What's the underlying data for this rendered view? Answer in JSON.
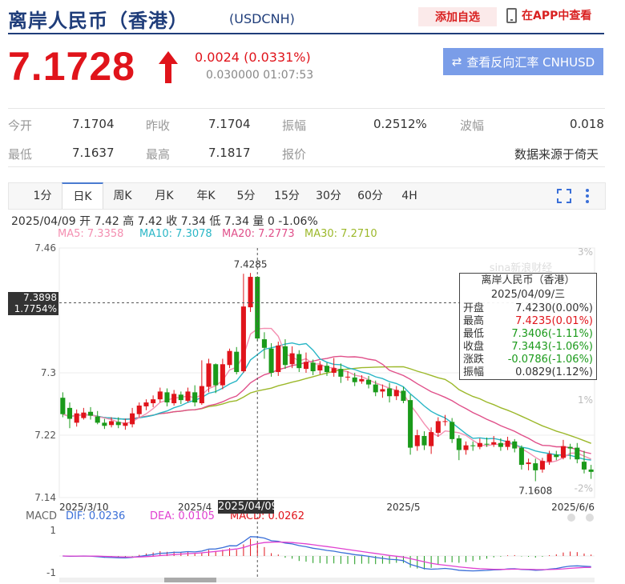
{
  "header": {
    "title": "离岸人民币（香港）",
    "code": "(USDCNH)",
    "watch_label": "添加自选",
    "app_label": "在APP中查看"
  },
  "quote": {
    "price": "7.1728",
    "change": "0.0024 (0.0331%)",
    "sub": "0.030000 01:07:53",
    "reverse_label": "查看反向汇率 CNHUSD",
    "up_color": "#e0141b"
  },
  "stats": [
    [
      {
        "label": "今开",
        "value": "7.1704"
      },
      {
        "label": "昨收",
        "value": "7.1704"
      },
      {
        "label": "振幅",
        "value": "0.2512%"
      },
      {
        "label": "波幅",
        "value": "0.018"
      }
    ],
    [
      {
        "label": "最低",
        "value": "7.1637"
      },
      {
        "label": "最高",
        "value": "7.1817"
      },
      {
        "label": "报价",
        "value": ""
      },
      {
        "label": "",
        "value": "数据来源于倚天"
      }
    ]
  ],
  "tabs": [
    "1分",
    "日K",
    "周K",
    "月K",
    "年K",
    "5分",
    "15分",
    "30分",
    "60分",
    "4H"
  ],
  "active_tab": "日K",
  "ohlc_line": "2025/04/09 开 7.42 高 7.42 收 7.34 低 7.34 量 0 -1.06%",
  "ma": [
    {
      "label": "MA5: 7.3358",
      "color": "#f48fb1"
    },
    {
      "label": "MA10: 7.3078",
      "color": "#29b6c6"
    },
    {
      "label": "MA20: 7.2773",
      "color": "#e0508a"
    },
    {
      "label": "MA30: 7.2710",
      "color": "#9cb82a"
    }
  ],
  "macd": [
    {
      "label": "MACD",
      "color": "#666"
    },
    {
      "label": "DIF: 0.0236",
      "color": "#3a6fd8"
    },
    {
      "label": "DEA: 0.0105",
      "color": "#e040d0"
    },
    {
      "label": "MACD: 0.0262",
      "color": "#e0141b"
    }
  ],
  "tooltip": {
    "title": "离岸人民币（香港）",
    "date": "2025/04/09/三",
    "rows": [
      {
        "k": "开盘",
        "v": "7.4230(0.00%)",
        "c": "#333"
      },
      {
        "k": "最高",
        "v": "7.4235(0.01%)",
        "c": "#e0141b"
      },
      {
        "k": "最低",
        "v": "7.3406(-1.11%)",
        "c": "#1a9a1a"
      },
      {
        "k": "收盘",
        "v": "7.3443(-1.06%)",
        "c": "#1a9a1a"
      },
      {
        "k": "涨跌",
        "v": "-0.0786(-1.06%)",
        "c": "#1a9a1a"
      },
      {
        "k": "振幅",
        "v": "0.0829(1.12%)",
        "c": "#333"
      }
    ]
  },
  "crosshair": {
    "price": "7.3898",
    "pct": "1.7754%",
    "date": "2025/04/09"
  },
  "chart_data": {
    "type": "candlestick",
    "y_labels": [
      "7.46",
      "7.3",
      "7.22",
      "7.14"
    ],
    "y_values": [
      7.46,
      7.3,
      7.22,
      7.14
    ],
    "right_labels": [
      "3%",
      "1%",
      "-2%"
    ],
    "x_labels": [
      "2025/3/10",
      "2025/4",
      "2025/5",
      "2025/6/6"
    ],
    "high_label": "7.4285",
    "low_label": "7.1608",
    "macd_axis": [
      "1",
      "-1"
    ],
    "watermark": "sina新浪财经",
    "candles": [
      [
        7.268,
        7.247,
        7.275,
        7.243
      ],
      [
        7.255,
        7.241,
        7.262,
        7.229
      ],
      [
        7.236,
        7.248,
        7.253,
        7.231
      ],
      [
        7.242,
        7.249,
        7.255,
        7.24
      ],
      [
        7.25,
        7.245,
        7.256,
        7.24
      ],
      [
        7.244,
        7.236,
        7.251,
        7.234
      ],
      [
        7.236,
        7.232,
        7.241,
        7.228
      ],
      [
        7.233,
        7.238,
        7.243,
        7.23
      ],
      [
        7.237,
        7.233,
        7.243,
        7.229
      ],
      [
        7.232,
        7.236,
        7.241,
        7.227
      ],
      [
        7.234,
        7.248,
        7.255,
        7.23
      ],
      [
        7.247,
        7.258,
        7.262,
        7.243
      ],
      [
        7.257,
        7.262,
        7.266,
        7.252
      ],
      [
        7.261,
        7.266,
        7.271,
        7.256
      ],
      [
        7.266,
        7.276,
        7.281,
        7.262
      ],
      [
        7.275,
        7.262,
        7.28,
        7.257
      ],
      [
        7.261,
        7.273,
        7.278,
        7.258
      ],
      [
        7.272,
        7.265,
        7.276,
        7.26
      ],
      [
        7.264,
        7.276,
        7.281,
        7.262
      ],
      [
        7.275,
        7.262,
        7.284,
        7.257
      ],
      [
        7.261,
        7.283,
        7.316,
        7.259
      ],
      [
        7.282,
        7.312,
        7.318,
        7.275
      ],
      [
        7.311,
        7.284,
        7.312,
        7.274
      ],
      [
        7.284,
        7.311,
        7.318,
        7.279
      ],
      [
        7.31,
        7.328,
        7.331,
        7.306
      ],
      [
        7.327,
        7.301,
        7.333,
        7.298
      ],
      [
        7.302,
        7.385,
        7.427,
        7.3
      ],
      [
        7.384,
        7.423,
        7.428,
        7.378
      ],
      [
        7.423,
        7.344,
        7.424,
        7.341
      ],
      [
        7.343,
        7.332,
        7.352,
        7.318
      ],
      [
        7.331,
        7.3,
        7.338,
        7.295
      ],
      [
        7.301,
        7.335,
        7.34,
        7.296
      ],
      [
        7.334,
        7.31,
        7.343,
        7.305
      ],
      [
        7.311,
        7.325,
        7.334,
        7.306
      ],
      [
        7.324,
        7.306,
        7.329,
        7.301
      ],
      [
        7.305,
        7.314,
        7.326,
        7.3
      ],
      [
        7.313,
        7.302,
        7.317,
        7.297
      ],
      [
        7.303,
        7.31,
        7.315,
        7.298
      ],
      [
        7.309,
        7.301,
        7.313,
        7.296
      ],
      [
        7.3,
        7.306,
        7.319,
        7.295
      ],
      [
        7.305,
        7.295,
        7.312,
        7.287
      ],
      [
        7.294,
        7.295,
        7.302,
        7.29
      ],
      [
        7.294,
        7.288,
        7.3,
        7.283
      ],
      [
        7.289,
        7.292,
        7.297,
        7.286
      ],
      [
        7.291,
        7.285,
        7.296,
        7.28
      ],
      [
        7.285,
        7.275,
        7.29,
        7.27
      ],
      [
        7.276,
        7.279,
        7.285,
        7.268
      ],
      [
        7.28,
        7.27,
        7.287,
        7.262
      ],
      [
        7.27,
        7.278,
        7.283,
        7.265
      ],
      [
        7.277,
        7.264,
        7.282,
        7.261
      ],
      [
        7.265,
        7.204,
        7.272,
        7.195
      ],
      [
        7.206,
        7.22,
        7.227,
        7.2
      ],
      [
        7.219,
        7.207,
        7.225,
        7.201
      ],
      [
        7.206,
        7.224,
        7.23,
        7.196
      ],
      [
        7.223,
        7.238,
        7.243,
        7.218
      ],
      [
        7.237,
        7.238,
        7.246,
        7.232
      ],
      [
        7.237,
        7.215,
        7.242,
        7.21
      ],
      [
        7.216,
        7.201,
        7.22,
        7.188
      ],
      [
        7.201,
        7.207,
        7.212,
        7.195
      ],
      [
        7.207,
        7.206,
        7.212,
        7.2
      ],
      [
        7.205,
        7.21,
        7.216,
        7.202
      ],
      [
        7.209,
        7.208,
        7.217,
        7.205
      ],
      [
        7.208,
        7.211,
        7.219,
        7.205
      ],
      [
        7.21,
        7.205,
        7.216,
        7.2
      ],
      [
        7.205,
        7.213,
        7.218,
        7.201
      ],
      [
        7.212,
        7.203,
        7.215,
        7.198
      ],
      [
        7.204,
        7.182,
        7.207,
        7.176
      ],
      [
        7.183,
        7.185,
        7.19,
        7.175
      ],
      [
        7.184,
        7.175,
        7.19,
        7.161
      ],
      [
        7.176,
        7.187,
        7.191,
        7.172
      ],
      [
        7.186,
        7.196,
        7.2,
        7.182
      ],
      [
        7.195,
        7.192,
        7.2,
        7.188
      ],
      [
        7.191,
        7.206,
        7.214,
        7.189
      ],
      [
        7.205,
        7.203,
        7.209,
        7.189
      ],
      [
        7.204,
        7.189,
        7.21,
        7.184
      ],
      [
        7.186,
        7.176,
        7.2,
        7.171
      ],
      [
        7.176,
        7.173,
        7.182,
        7.164
      ]
    ]
  }
}
